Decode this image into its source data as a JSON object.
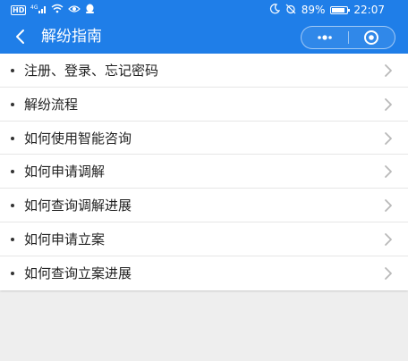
{
  "status_bar": {
    "hd_badge": "HD",
    "network": "4G",
    "battery": "89%",
    "battery_level": 0.89,
    "time": "22:07"
  },
  "nav": {
    "title": "解纷指南"
  },
  "menu": {
    "items": [
      {
        "label": "注册、登录、忘记密码"
      },
      {
        "label": "解纷流程"
      },
      {
        "label": "如何使用智能咨询"
      },
      {
        "label": "如何申请调解"
      },
      {
        "label": "如何查询调解进展"
      },
      {
        "label": "如何申请立案"
      },
      {
        "label": "如何查询立案进展"
      }
    ]
  },
  "colors": {
    "header_bg": "#1f7ee8",
    "page_bg": "#eeeeee",
    "chevron": "#b9b9b9"
  }
}
